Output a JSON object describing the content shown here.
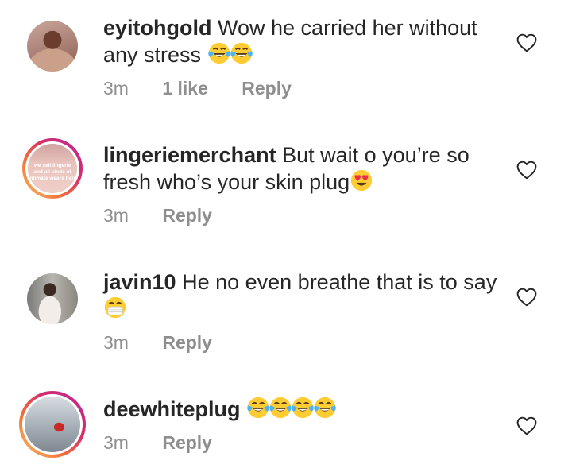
{
  "comments": [
    {
      "username": "eyitohgold",
      "text": "Wow he carried her without any stress",
      "emojis": [
        "face-with-tears-of-joy",
        "face-with-tears-of-joy"
      ],
      "time": "3m",
      "likes": "1 like",
      "reply": "Reply",
      "avatar": "woman-portrait-photo",
      "story_ring": false
    },
    {
      "username": "lingeriemerchant",
      "text": "But wait o you’re so fresh who’s your skin plug",
      "emojis": [
        "smiling-face-with-heart-eyes"
      ],
      "time": "3m",
      "reply": "Reply",
      "avatar": "lingerie-shop-logo",
      "avatar_text": [
        "we sell lingerie",
        "and all kinds of",
        "intimate wears here"
      ],
      "story_ring": true
    },
    {
      "username": "javin10",
      "text": "He no even breathe that is to say",
      "emojis": [
        "face-with-medical-mask"
      ],
      "time": "3m",
      "reply": "Reply",
      "avatar": "child-photo",
      "story_ring": false
    },
    {
      "username": "deewhiteplug",
      "text": "",
      "emojis": [
        "face-with-tears-of-joy",
        "face-with-tears-of-joy",
        "face-with-tears-of-joy",
        "face-with-tears-of-joy"
      ],
      "time": "3m",
      "reply": "Reply",
      "avatar": "man-on-stairs-photo",
      "story_ring": true
    }
  ],
  "colors": {
    "text": "#262626",
    "meta": "#8e8e8e",
    "story_ring_start": "#f9c16a",
    "story_ring_end": "#b62d9b"
  }
}
